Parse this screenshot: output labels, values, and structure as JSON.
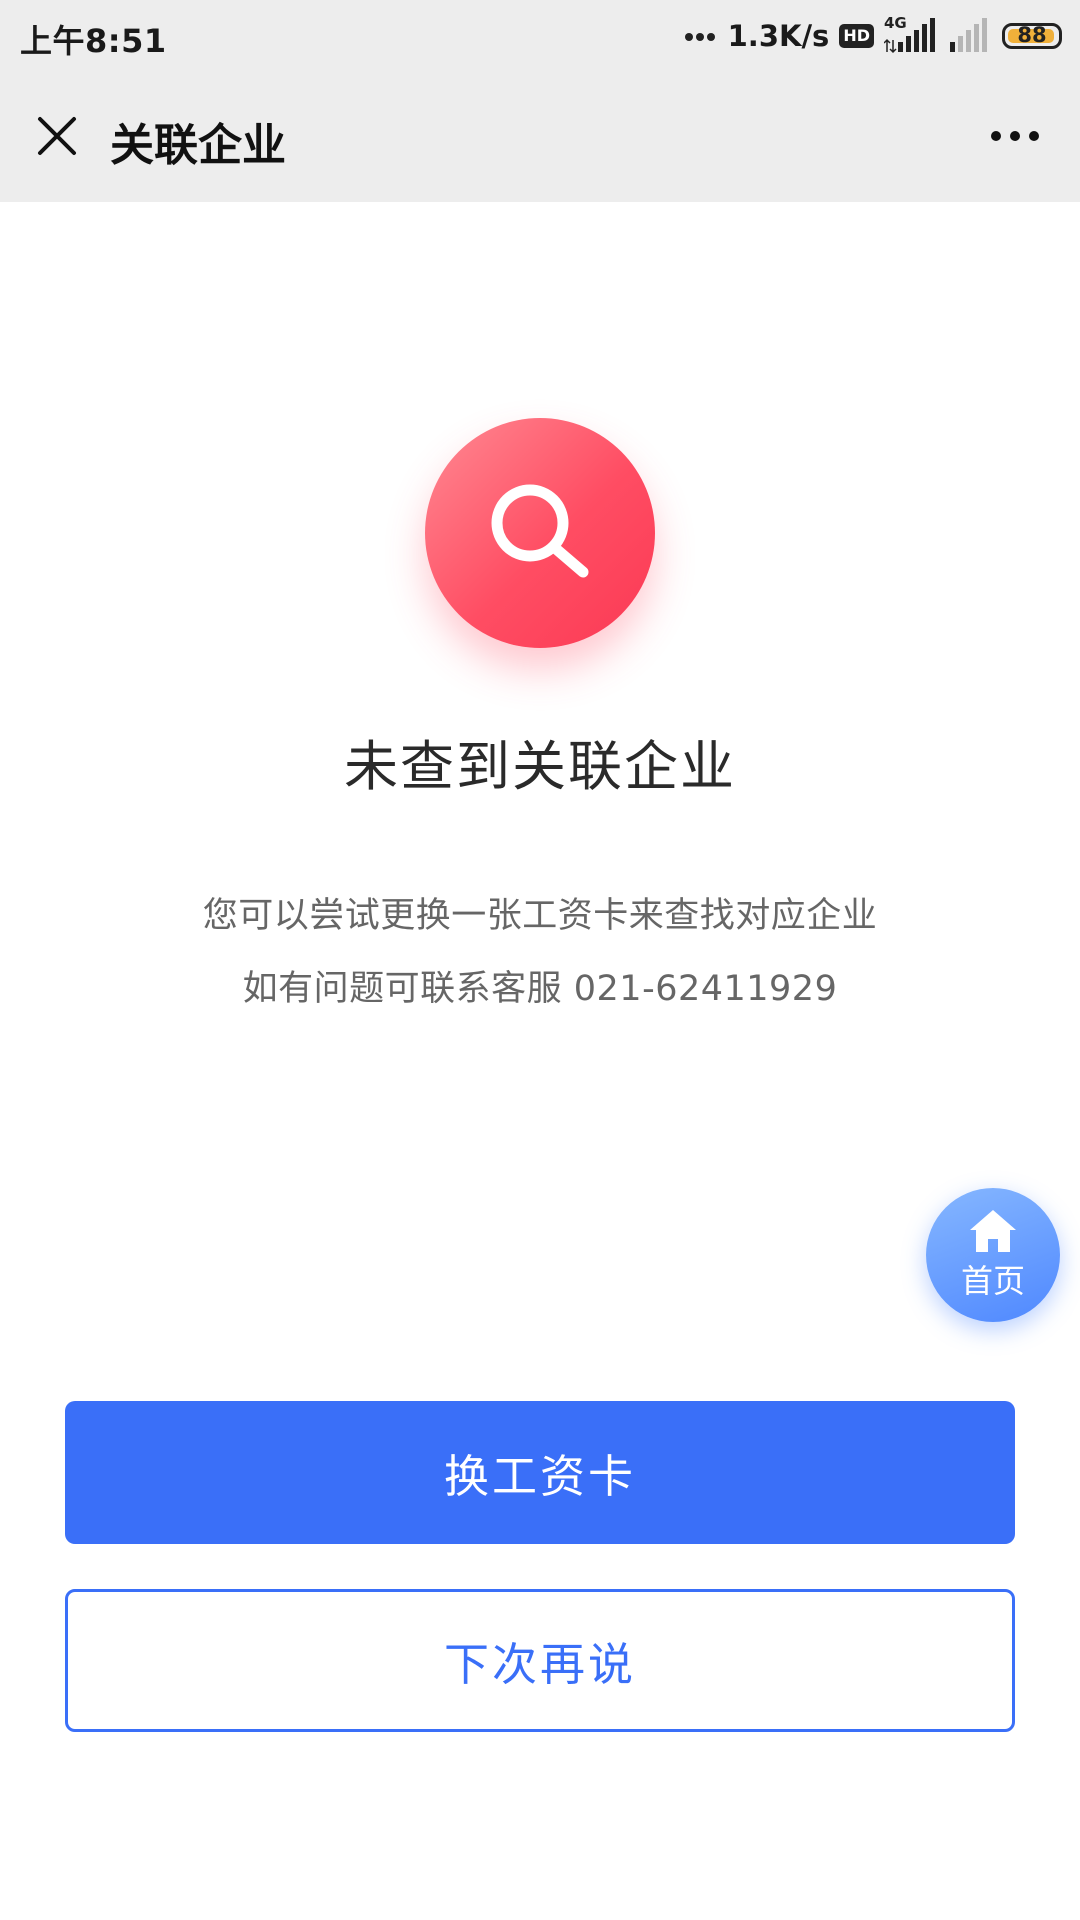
{
  "status_bar": {
    "time": "上午8:51",
    "net_speed": "1.3K/s",
    "hd_label": "HD",
    "network_type": "4G",
    "battery_level": "88"
  },
  "nav": {
    "title": "关联企业",
    "close_icon": "close-icon",
    "more_icon": "more-icon"
  },
  "main": {
    "icon": "search-icon",
    "title": "未查到关联企业",
    "tip_line1": "您可以尝试更换一张工资卡来查找对应企业",
    "tip_line2": "如有问题可联系客服 021-62411929"
  },
  "home_fab": {
    "icon": "home-icon",
    "label": "首页"
  },
  "actions": {
    "primary_label": "换工资卡",
    "secondary_label": "下次再说"
  },
  "colors": {
    "accent": "#3a6ff8",
    "badge_red": "#ff4d63",
    "nav_bg": "#ededed",
    "battery": "#f0b03a"
  }
}
